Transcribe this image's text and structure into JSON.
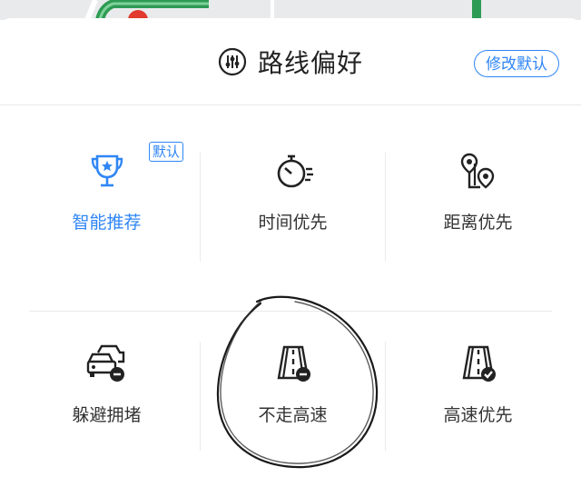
{
  "header": {
    "title": "路线偏好",
    "edit_default_label": "修改默认"
  },
  "options": [
    {
      "label": "智能推荐",
      "icon": "trophy-icon",
      "selected": true,
      "badge": "默认"
    },
    {
      "label": "时间优先",
      "icon": "stopwatch-icon",
      "selected": false
    },
    {
      "label": "距离优先",
      "icon": "route-distance-icon",
      "selected": false
    },
    {
      "label": "躲避拥堵",
      "icon": "avoid-congestion-icon",
      "selected": false
    },
    {
      "label": "不走高速",
      "icon": "no-highway-icon",
      "selected": false
    },
    {
      "label": "高速优先",
      "icon": "highway-priority-icon",
      "selected": false
    }
  ],
  "colors": {
    "accent": "#2f86f6",
    "text": "#333333",
    "divider": "#ebebeb"
  }
}
